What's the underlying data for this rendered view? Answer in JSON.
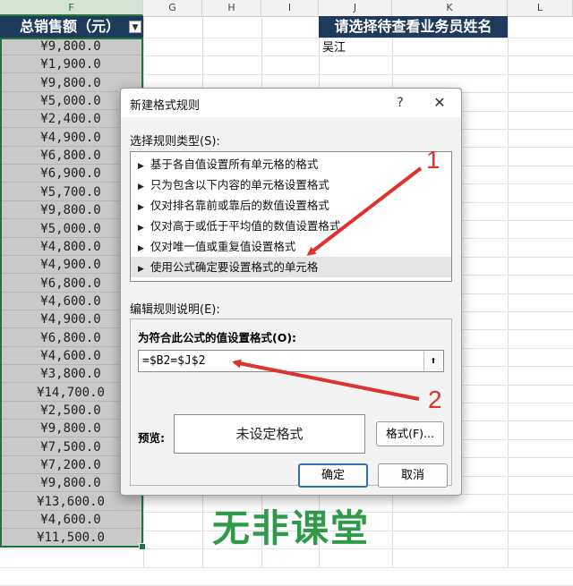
{
  "columns": [
    "F",
    "G",
    "H",
    "I",
    "J",
    "K",
    "L"
  ],
  "header_f": "总销售额（元）",
  "header_j": "请选择待查看业务员姓名",
  "cell_j2": "吴江",
  "f_values": [
    "¥9,800.0",
    "¥1,900.0",
    "¥9,800.0",
    "¥5,000.0",
    "¥2,400.0",
    "¥4,900.0",
    "¥6,800.0",
    "¥6,900.0",
    "¥5,700.0",
    "¥9,800.0",
    "¥5,000.0",
    "¥4,800.0",
    "¥4,900.0",
    "¥6,800.0",
    "¥4,600.0",
    "¥4,900.0",
    "¥6,800.0",
    "¥4,600.0",
    "¥3,800.0",
    "¥14,700.0",
    "¥2,500.0",
    "¥9,800.0",
    "¥7,500.0",
    "¥7,200.0",
    "¥9,800.0",
    "¥13,600.0",
    "¥4,600.0",
    "¥11,500.0"
  ],
  "dialog": {
    "title": "新建格式规则",
    "help": "?",
    "close": "✕",
    "select_rule_label": "选择规则类型(S):",
    "rules": [
      "基于各自值设置所有单元格的格式",
      "只为包含以下内容的单元格设置格式",
      "仅对排名靠前或靠后的数值设置格式",
      "仅对高于或低于平均值的数值设置格式",
      "仅对唯一值或重复值设置格式",
      "使用公式确定要设置格式的单元格"
    ],
    "selected_rule_index": 5,
    "edit_label": "编辑规则说明(E):",
    "formula_label": "为符合此公式的值设置格式(O):",
    "formula_value": "=$B2=$J$2",
    "preview_label": "预览:",
    "preview_text": "未设定格式",
    "format_button": "格式(F)...",
    "ok_button": "确定",
    "cancel_button": "取消"
  },
  "annotations": {
    "marker1": "1",
    "marker2": "2"
  },
  "watermark": "无非课堂",
  "colors": {
    "header_bg": "#1f3b5c",
    "accent_red": "#e0312c",
    "excel_green": "#217346",
    "watermark": "#2f9a4a"
  }
}
